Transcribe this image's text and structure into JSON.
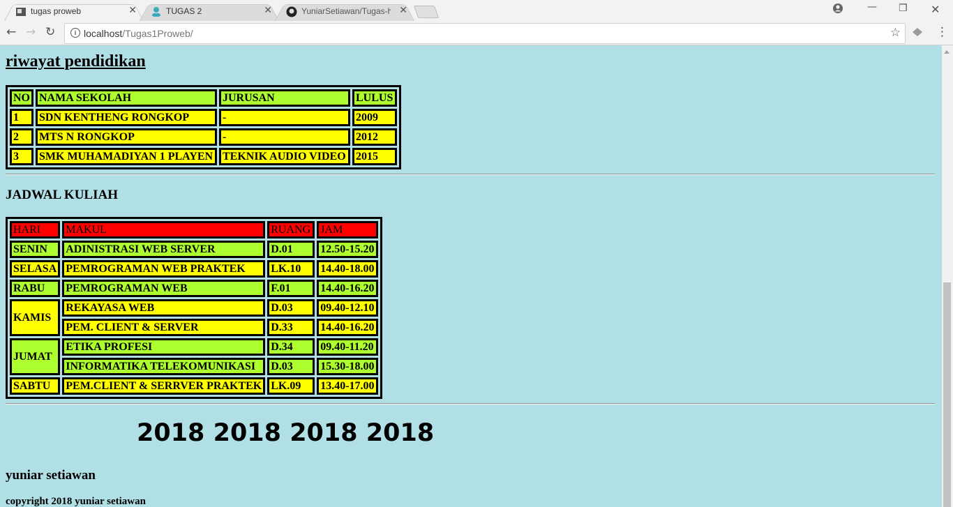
{
  "browser": {
    "tabs": [
      {
        "label": "tugas proweb",
        "icon": "page-favicon-icon",
        "active": true
      },
      {
        "label": "TUGAS 2",
        "icon": "person-favicon-icon",
        "active": false
      },
      {
        "label": "YuniarSetiawan/Tugas-ht",
        "icon": "github-icon",
        "active": false
      }
    ],
    "close_glyph": "✕",
    "url_host": "localhost",
    "url_path": "/Tugas1Proweb/"
  },
  "page": {
    "riwayat_title": "riwayat pendidikan",
    "riwayat_table": {
      "headers": [
        "NO",
        "NAMA SEKOLAH",
        "JURUSAN",
        "LULUS"
      ],
      "rows": [
        [
          "1",
          "SDN KENTHENG RONGKOP",
          "-",
          "2009"
        ],
        [
          "2",
          "MTS N RONGKOP",
          "-",
          "2012"
        ],
        [
          "3",
          "SMK MUHAMADIYAN 1 PLAYEN",
          "TEKNIK AUDIO VIDEO",
          "2015"
        ]
      ]
    },
    "jadwal_title": "JADWAL KULIAH",
    "jadwal_table": {
      "headers": [
        "HARI",
        "MAKUL",
        "RUANG",
        "JAM"
      ],
      "rows": [
        {
          "hari": "SENIN",
          "makul": "ADINISTRASI WEB SERVER",
          "ruang": "D.01",
          "jam": "12.50-15.20"
        },
        {
          "hari": "SELASA",
          "makul": "PEMROGRAMAN WEB PRAKTEK",
          "ruang": "LK.10",
          "jam": "14.40-18.00"
        },
        {
          "hari": "RABU",
          "makul": "PEMROGRAMAN WEB",
          "ruang": "F.01",
          "jam": "14.40-16.20"
        },
        {
          "hari": "KAMIS",
          "makul": "REKAYASA WEB",
          "ruang": "D.03",
          "jam": "09.40-12.10"
        },
        {
          "hari": "",
          "makul": "PEM. CLIENT & SERVER",
          "ruang": "D.33",
          "jam": "14.40-16.20"
        },
        {
          "hari": "JUMAT",
          "makul": "ETIKA PROFESI",
          "ruang": "D.34",
          "jam": "09.40-11.20"
        },
        {
          "hari": "",
          "makul": "INFORMATIKA TELEKOMUNIKASI",
          "ruang": "D.03",
          "jam": "15.30-18.00"
        },
        {
          "hari": "SABTU",
          "makul": "PEM.CLIENT & SERRVER PRAKTEK",
          "ruang": "LK.09",
          "jam": "13.40-17.00"
        }
      ]
    },
    "years_banner": "2018 2018 2018 2018",
    "author": "yuniar setiawan",
    "copyright": "copyright 2018 yuniar setiawan"
  },
  "colors": {
    "page_bg": "#b0dfe5",
    "green": "#adff2f",
    "yellow": "#ffff00",
    "red": "#ff0000"
  }
}
